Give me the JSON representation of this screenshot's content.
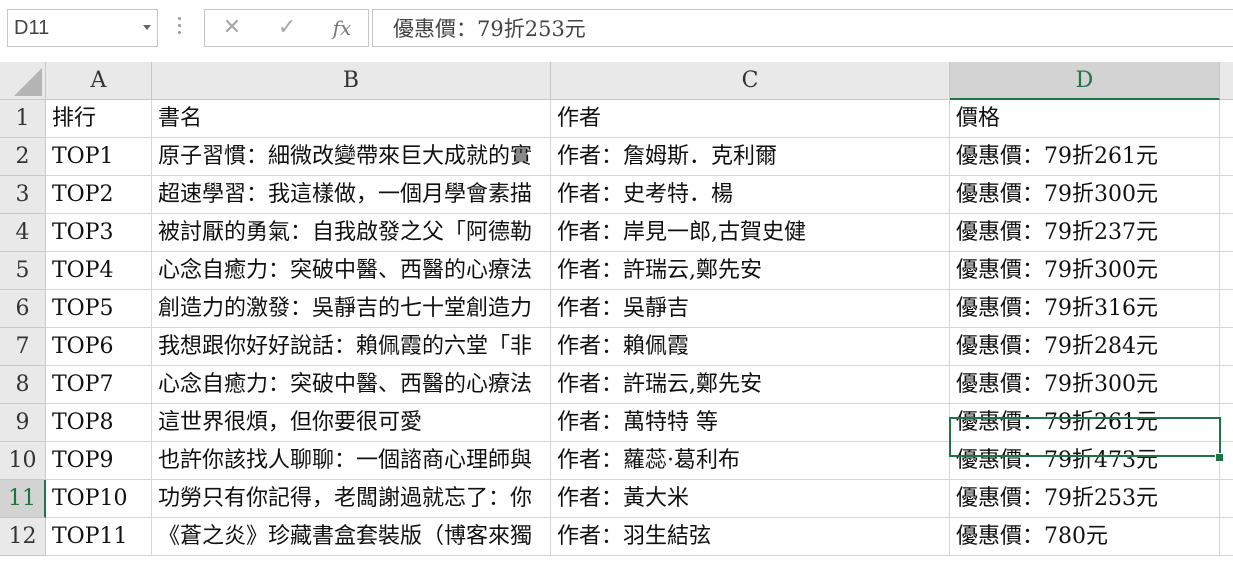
{
  "formula_bar": {
    "name_box": "D11",
    "cancel_glyph": "✕",
    "enter_glyph": "✓",
    "fx_label": "fx",
    "formula": "優惠價：79折253元"
  },
  "columns": [
    "A",
    "B",
    "C",
    "D"
  ],
  "selected_column": "D",
  "selected_row": "11",
  "rows": [
    {
      "num": "1",
      "a": "排行",
      "b": "書名",
      "c": "作者",
      "d": "價格"
    },
    {
      "num": "2",
      "a": "TOP1",
      "b": "原子習慣：細微改變帶來巨大成就的實",
      "c": "作者：詹姆斯．克利爾",
      "d": "優惠價：79折261元"
    },
    {
      "num": "3",
      "a": "TOP2",
      "b": "超速學習：我這樣做，一個月學會素描",
      "c": "作者：史考特．楊",
      "d": "優惠價：79折300元"
    },
    {
      "num": "4",
      "a": "TOP3",
      "b": "被討厭的勇氣：自我啟發之父「阿德勒",
      "c": "作者：岸見一郎,古賀史健",
      "d": "優惠價：79折237元"
    },
    {
      "num": "5",
      "a": "TOP4",
      "b": "心念自癒力：突破中醫、西醫的心療法",
      "c": "作者：許瑞云,鄭先安",
      "d": "優惠價：79折300元"
    },
    {
      "num": "6",
      "a": "TOP5",
      "b": "創造力的激發：吳靜吉的七十堂創造力",
      "c": "作者：吳靜吉",
      "d": "優惠價：79折316元"
    },
    {
      "num": "7",
      "a": "TOP6",
      "b": "我想跟你好好說話：賴佩霞的六堂「非",
      "c": "作者：賴佩霞",
      "d": "優惠價：79折284元"
    },
    {
      "num": "8",
      "a": "TOP7",
      "b": "心念自癒力：突破中醫、西醫的心療法",
      "c": "作者：許瑞云,鄭先安",
      "d": "優惠價：79折300元"
    },
    {
      "num": "9",
      "a": "TOP8",
      "b": "這世界很煩，但你要很可愛",
      "c": "作者：萬特特 等",
      "d": "優惠價：79折261元"
    },
    {
      "num": "10",
      "a": "TOP9",
      "b": "也許你該找人聊聊：一個諮商心理師與",
      "c": "作者：蘿蕊·葛利布",
      "d": "優惠價：79折473元"
    },
    {
      "num": "11",
      "a": "TOP10",
      "b": "功勞只有你記得，老闆謝過就忘了：你",
      "c": "作者：黃大米",
      "d": "優惠價：79折253元"
    },
    {
      "num": "12",
      "a": "TOP11",
      "b": "《蒼之炎》珍藏書盒套裝版（博客來獨",
      "c": "作者：羽生結弦",
      "d": "優惠價：780元"
    }
  ],
  "colors": {
    "accent": "#217346",
    "header_bg": "#e9e9e9",
    "header_selected_bg": "#d3d3d3",
    "gridline": "#d6d6d6"
  }
}
